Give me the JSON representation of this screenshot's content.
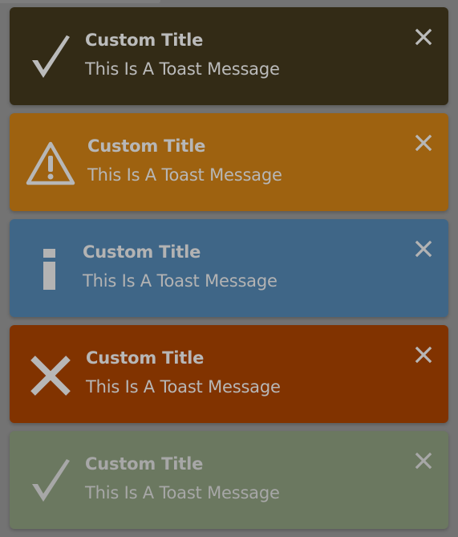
{
  "toasts": [
    {
      "type": "success",
      "icon": "checkmark-icon",
      "bg_color": "#332b16",
      "text_color": "#bbbbbb",
      "title": "Custom Title",
      "message": "This Is A Toast Message"
    },
    {
      "type": "warning",
      "icon": "warning-triangle-icon",
      "bg_color": "#9e6210",
      "text_color": "#b7b7b7",
      "title": "Custom Title",
      "message": "This Is A Toast Message"
    },
    {
      "type": "info",
      "icon": "info-icon",
      "bg_color": "#3f6687",
      "text_color": "#b3b3b3",
      "title": "Custom Title",
      "message": "This Is A Toast Message"
    },
    {
      "type": "error",
      "icon": "x-cross-icon",
      "bg_color": "#813300",
      "text_color": "#b7b7b7",
      "title": "Custom Title",
      "message": "This Is A Toast Message"
    },
    {
      "type": "success-muted",
      "icon": "checkmark-icon",
      "bg_color": "#6b7860",
      "text_color": "#a7a7a7",
      "title": "Custom Title",
      "message": "This Is A Toast Message"
    }
  ],
  "close_icon": "close-icon"
}
